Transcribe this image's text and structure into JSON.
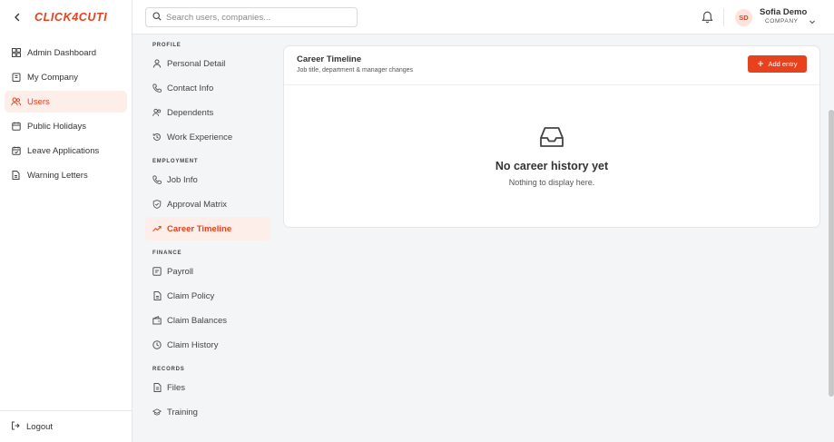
{
  "brand": {
    "logo_text": "CLICK4CUTI",
    "back_icon": "chevron-left-icon",
    "accent_color": "#e8411e"
  },
  "sidebar": {
    "items": [
      {
        "label": "Admin Dashboard",
        "icon": "dashboard-icon"
      },
      {
        "label": "My Company",
        "icon": "building-icon"
      },
      {
        "label": "Users",
        "icon": "users-icon",
        "active": true
      },
      {
        "label": "Public Holidays",
        "icon": "calendar-icon"
      },
      {
        "label": "Leave Applications",
        "icon": "calendar-check-icon"
      },
      {
        "label": "Warning Letters",
        "icon": "document-icon"
      }
    ],
    "logout_label": "Logout"
  },
  "header": {
    "search_placeholder": "Search users, companies...",
    "avatar_initials": "SD",
    "user_name": "Sofia Demo",
    "user_role": "COMPANY"
  },
  "subnav": {
    "profile_label": "PROFILE",
    "profile_items": [
      "Personal Detail",
      "Contact Info",
      "Dependents",
      "Work Experience"
    ],
    "employment_label": "EMPLOYMENT",
    "employment_items": [
      "Job Info",
      "Approval Matrix",
      "Career Timeline"
    ],
    "finance_label": "FINANCE",
    "finance_items": [
      "Payroll",
      "Claim Policy",
      "Claim Balances",
      "Claim History"
    ],
    "records_label": "RECORDS",
    "records_items": [
      "Files",
      "Training"
    ],
    "active_item": "Career Timeline"
  },
  "card": {
    "title": "Career Timeline",
    "subtitle": "Job title, department & manager changes",
    "add_button": "Add entry",
    "empty_icon": "inbox-icon",
    "empty_title": "No career history yet",
    "empty_subtitle": "Nothing to display here."
  }
}
